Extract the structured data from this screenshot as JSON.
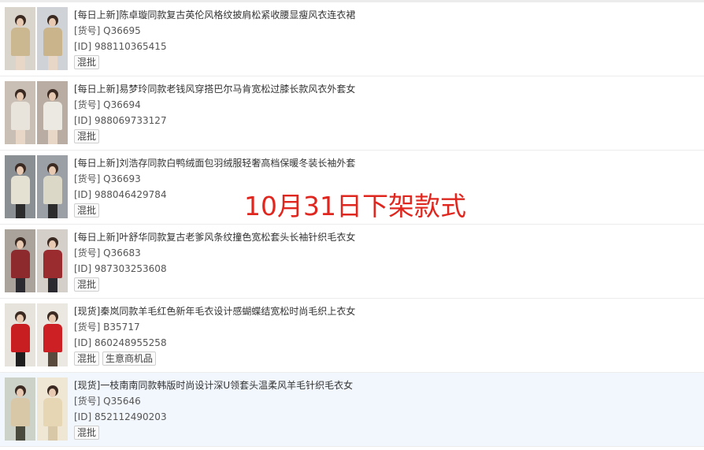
{
  "overlay_text": "10月31日下架款式",
  "products": [
    {
      "title": "[每日上新]陈卓璇同款复古英伦风格纹披肩松紧收腰显瘦风衣连衣裙",
      "sku": "[货号] Q36695",
      "id": "[ID] 988110365415",
      "tags": [
        "混批"
      ],
      "colors": [
        "#ccb890",
        "#c9b48c"
      ]
    },
    {
      "title": "[每日上新]易梦玲同款老钱风穿搭巴尔马肯宽松过膝长款风衣外套女",
      "sku": "[货号] Q36694",
      "id": "[ID] 988069733127",
      "tags": [
        "混批"
      ],
      "colors": [
        "#e8e4dc",
        "#ece9e3"
      ]
    },
    {
      "title": "[每日上新]刘浩存同款白鸭绒面包羽绒服轻奢高档保暖冬装长袖外套",
      "sku": "[货号] Q36693",
      "id": "[ID] 988046429784",
      "tags": [
        "混批"
      ],
      "colors": [
        "#e4e0d2",
        "#dcd8c8"
      ]
    },
    {
      "title": "[每日上新]叶舒华同款复古老爹风条纹撞色宽松套头长袖针织毛衣女",
      "sku": "[货号] Q36683",
      "id": "[ID] 987303253608",
      "tags": [
        "混批"
      ],
      "colors": [
        "#8c2a2e",
        "#9a2c30"
      ]
    },
    {
      "title": "[现货]秦岚同款羊毛红色新年毛衣设计感蝴蝶结宽松时尚毛织上衣女",
      "sku": "[货号] B35717",
      "id": "[ID] 860248955258",
      "tags": [
        "混批",
        "生意商机品"
      ],
      "colors": [
        "#c81e22",
        "#cc2024"
      ]
    },
    {
      "title": "[现货]一枝南南同款韩版时尚设计深U领套头温柔风羊毛针织毛衣女",
      "sku": "[货号] Q35646",
      "id": "[ID] 852112490203",
      "tags": [
        "混批"
      ],
      "colors": [
        "#d8c8a8",
        "#e6d6b4"
      ]
    }
  ]
}
